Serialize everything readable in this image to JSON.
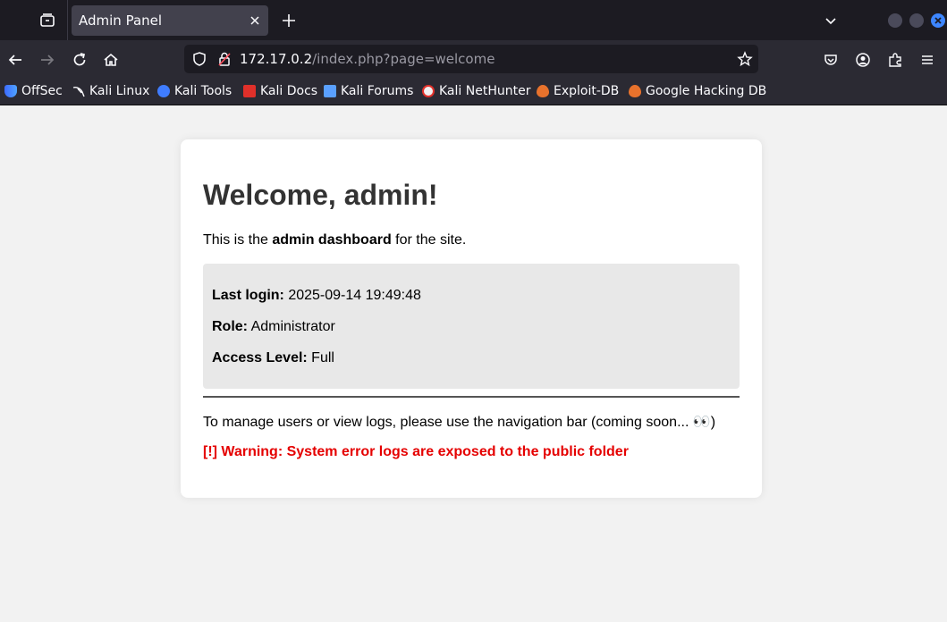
{
  "tab": {
    "title": "Admin Panel"
  },
  "address": {
    "host": "172.17.0.2",
    "path": "/index.php?page=welcome"
  },
  "bookmarks": [
    {
      "label": "OffSec",
      "icon": "offsec-icon"
    },
    {
      "label": "Kali Linux",
      "icon": "kali-dragon-icon"
    },
    {
      "label": "Kali Tools",
      "icon": "kali-tools-icon"
    },
    {
      "label": "Kali Docs",
      "icon": "kali-docs-icon"
    },
    {
      "label": "Kali Forums",
      "icon": "kali-forums-icon"
    },
    {
      "label": "Kali NetHunter",
      "icon": "nethunter-icon"
    },
    {
      "label": "Exploit-DB",
      "icon": "exploit-db-icon"
    },
    {
      "label": "Google Hacking DB",
      "icon": "ghdb-icon"
    }
  ],
  "page": {
    "heading": "Welcome, admin!",
    "intro": {
      "prefix": "This is the ",
      "bold": "admin dashboard",
      "suffix": " for the site."
    },
    "info": {
      "last_login": {
        "label": "Last login:",
        "value": " 2025-09-14 19:49:48"
      },
      "role": {
        "label": "Role:",
        "value": " Administrator"
      },
      "access": {
        "label": "Access Level:",
        "value": " Full"
      }
    },
    "manage_text": "To manage users or view logs, please use the navigation bar (coming soon... 👀)",
    "warning": "[!] Warning: System error logs are exposed to the public folder"
  },
  "colors": {
    "warning": "#e50000",
    "heading": "#333333",
    "info_bg": "#e8e8e8",
    "page_bg": "#f2f2f2"
  }
}
